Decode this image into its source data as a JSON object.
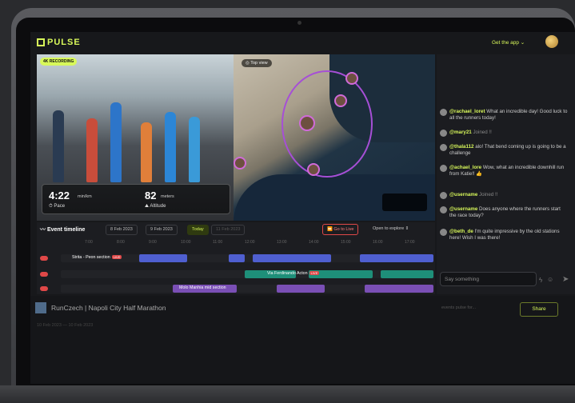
{
  "app": {
    "brand": "PULSE",
    "get_app": "Get the app ⌄"
  },
  "video": {
    "badge": "4K RECORDING",
    "pace_value": "4:22",
    "pace_unit": "min/km",
    "pace_label": "Pace",
    "altitude_value": "82",
    "altitude_unit": "meters",
    "altitude_label": "Altitude"
  },
  "map": {
    "top_view": "Top view"
  },
  "timeline": {
    "title": "Event timeline",
    "dates": [
      "8 Feb 2023",
      "9 Feb 2023",
      "Today",
      "11 Feb 2023"
    ],
    "go_live": "Go to Live",
    "explore": "Open to explore",
    "ticks": [
      "7:00",
      "8:00",
      "9:00",
      "10:00",
      "11:00",
      "12:00",
      "13:00",
      "14:00",
      "15:00",
      "16:00",
      "17:00"
    ],
    "segments": [
      "Strita - Peon section",
      "Via Ferdinando Acton",
      "Molo Manhia mid section"
    ]
  },
  "chat": {
    "messages": [
      {
        "user": "@rachael_loret",
        "text": " What an incredible day! Good luck to all the runners today!"
      },
      {
        "user": "@mary21",
        "text": " Joined !!"
      },
      {
        "user": "@thala112",
        "text": " alo! That bend coming up is going to be a challenge"
      },
      {
        "user": "@achael_lore",
        "text": " Wow, what an incredible downhill run from Katie!! 👍"
      },
      {
        "user": "@username",
        "text": " Joined !!"
      },
      {
        "user": "@username",
        "text": " Does anyone where the runners start the race today?"
      },
      {
        "user": "@beth_de",
        "text": " I'm quite impressive by the old stations here! Wish I was there!"
      }
    ],
    "placeholder": "Say something"
  },
  "event": {
    "title": "RunCzech | Napoli City Half Marathon",
    "dates": "10 Feb 2023  —  10 Feb 2023",
    "search_placeholder": "events pulse for...",
    "share": "Share"
  }
}
